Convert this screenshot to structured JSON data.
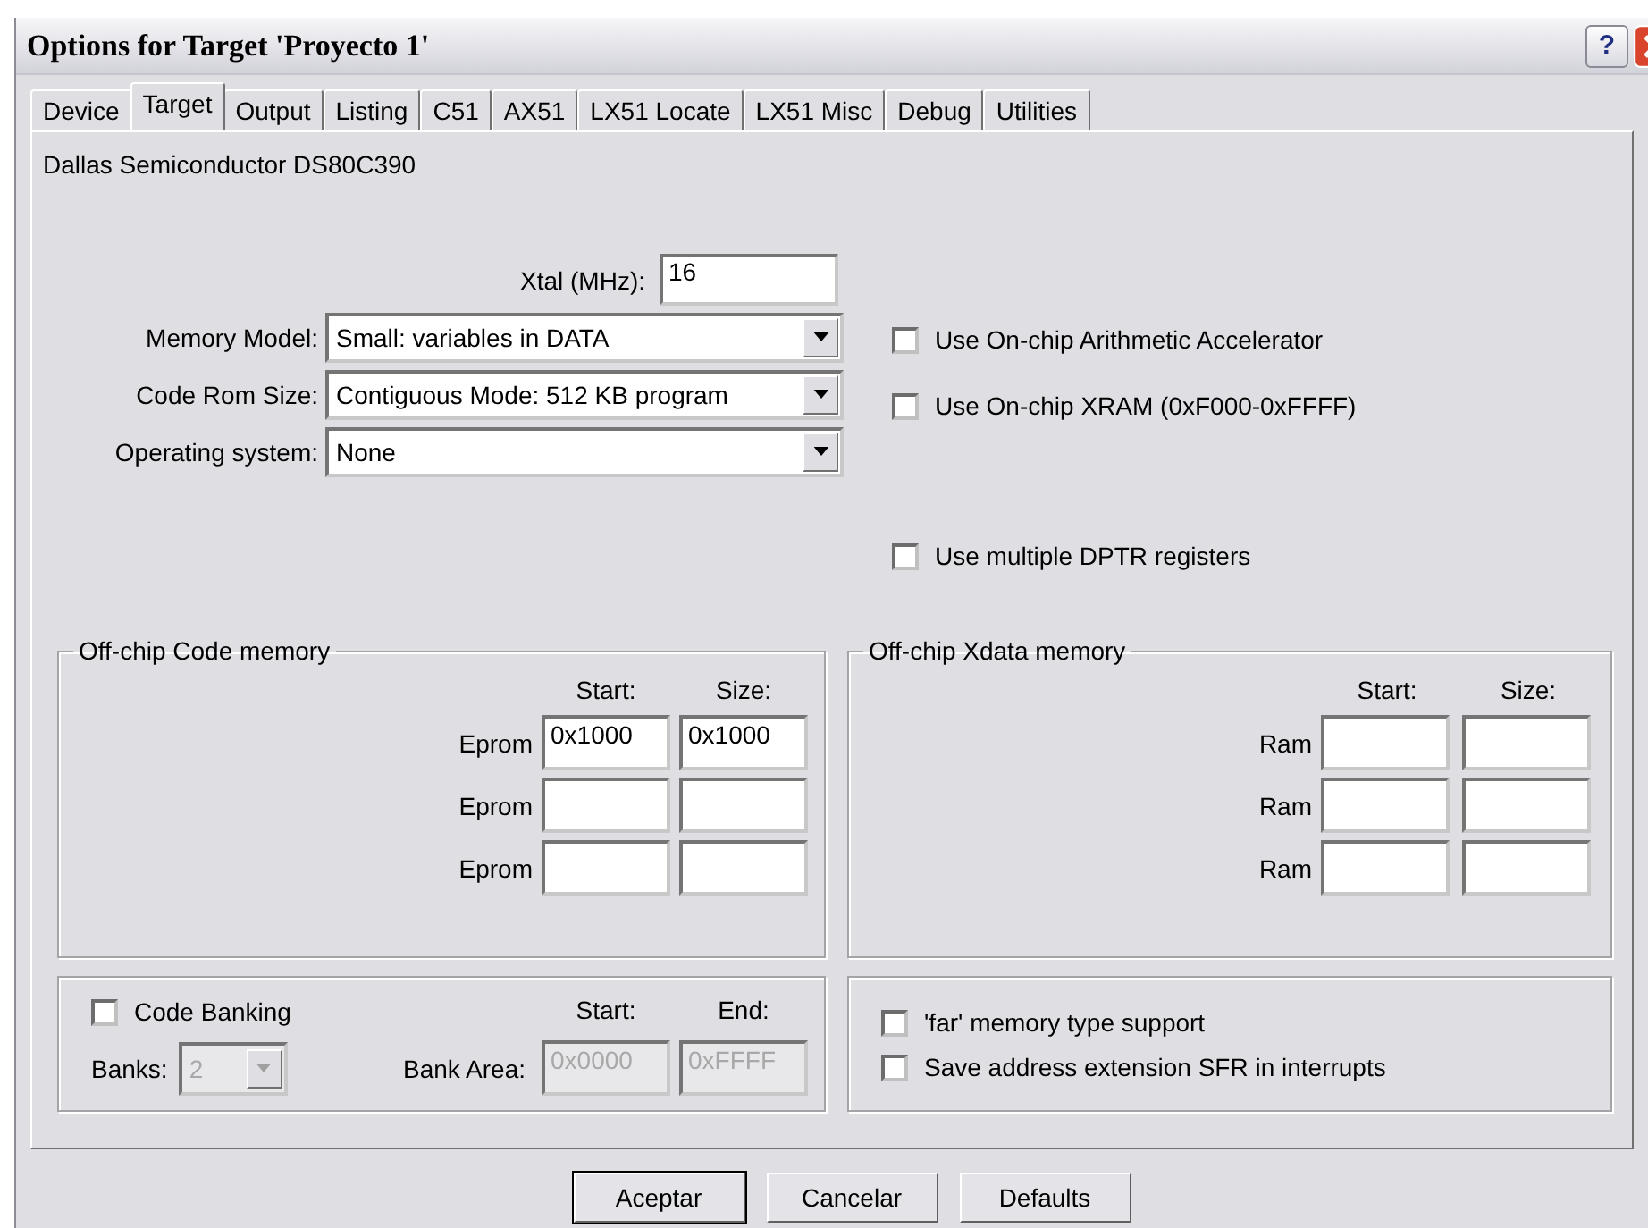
{
  "window": {
    "title": "Options for Target 'Proyecto 1'",
    "help_label": "?"
  },
  "tabs": [
    {
      "label": "Device",
      "selected": false
    },
    {
      "label": "Target",
      "selected": true
    },
    {
      "label": "Output",
      "selected": false
    },
    {
      "label": "Listing",
      "selected": false
    },
    {
      "label": "C51",
      "selected": false
    },
    {
      "label": "AX51",
      "selected": false
    },
    {
      "label": "LX51 Locate",
      "selected": false
    },
    {
      "label": "LX51 Misc",
      "selected": false
    },
    {
      "label": "Debug",
      "selected": false
    },
    {
      "label": "Utilities",
      "selected": false
    }
  ],
  "device": "Dallas Semiconductor DS80C390",
  "xtal": {
    "label": "Xtal (MHz):",
    "value": "16"
  },
  "dropdowns": [
    {
      "label": "Memory Model:",
      "value": "Small: variables in DATA"
    },
    {
      "label": "Code Rom Size:",
      "value": "Contiguous Mode: 512 KB program"
    },
    {
      "label": "Operating system:",
      "value": "None"
    }
  ],
  "options": [
    {
      "label": "Use On-chip Arithmetic Accelerator",
      "checked": false
    },
    {
      "label": "Use On-chip XRAM (0xF000-0xFFFF)",
      "checked": false
    },
    {
      "label": "Use multiple DPTR registers",
      "checked": false
    }
  ],
  "code_memory": {
    "title": "Off-chip Code memory",
    "headers": [
      "Start:",
      "Size:"
    ],
    "rows": [
      {
        "label": "Eprom",
        "start": "0x1000",
        "size": "0x1000"
      },
      {
        "label": "Eprom"
      },
      {
        "label": "Eprom"
      }
    ]
  },
  "xdata_memory": {
    "title": "Off-chip Xdata memory",
    "headers": [
      "Start:",
      "Size:"
    ],
    "rows": [
      {
        "label": "Ram"
      },
      {
        "label": "Ram"
      },
      {
        "label": "Ram"
      }
    ]
  },
  "banking": {
    "checkbox": {
      "label": "Code Banking",
      "checked": false
    },
    "headers": [
      "Start:",
      "End:"
    ],
    "banks": {
      "label": "Banks:",
      "value": "2",
      "disabled": true
    },
    "bank_area": {
      "label": "Bank Area:",
      "start": "0x0000",
      "end": "0xFFFF",
      "disabled": true
    }
  },
  "far_options": [
    {
      "label": "'far' memory type support",
      "checked": false
    },
    {
      "label": "Save address extension SFR in interrupts",
      "checked": false
    }
  ],
  "buttons": [
    {
      "label": "Aceptar",
      "default": true
    },
    {
      "label": "Cancelar",
      "default": false
    },
    {
      "label": "Defaults",
      "default": false
    }
  ]
}
